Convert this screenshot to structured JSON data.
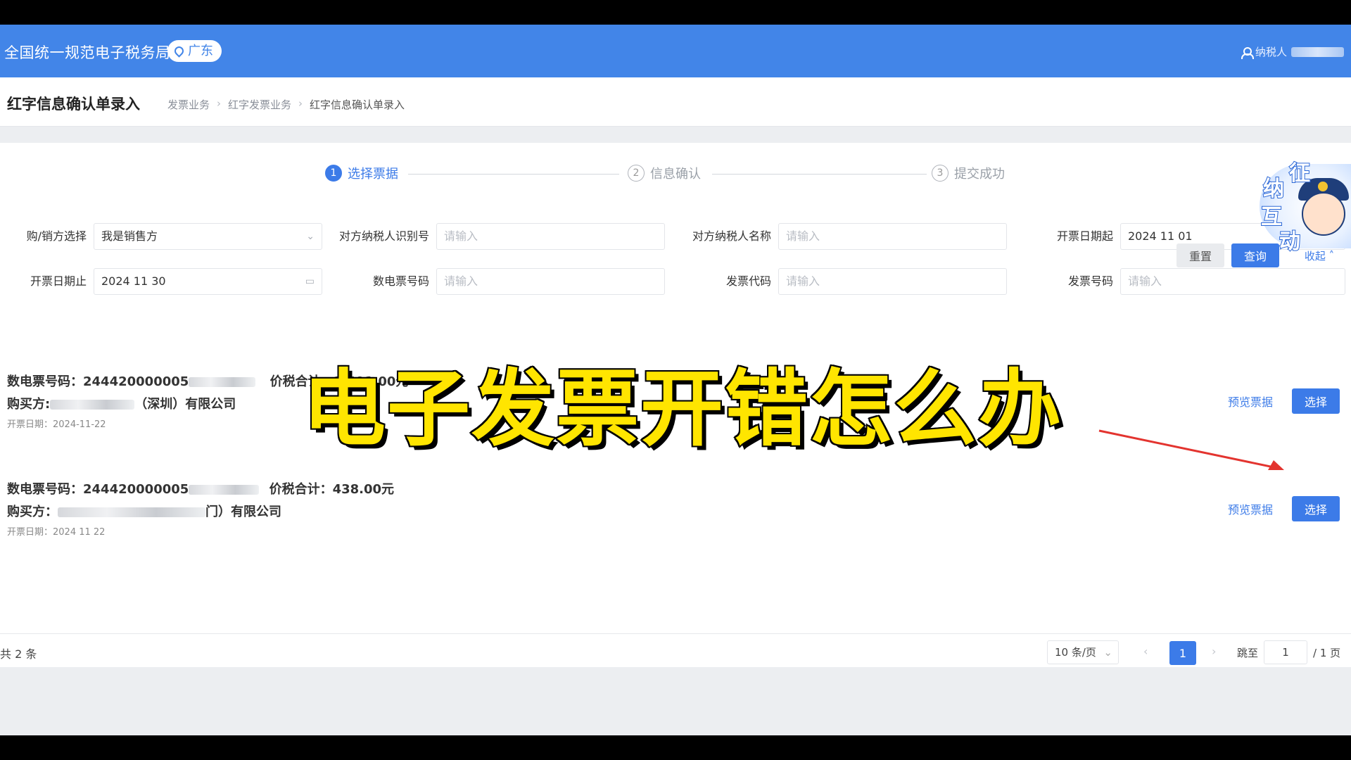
{
  "header": {
    "brand": "全国统一规范电子税务局",
    "region": "广东",
    "user": "纳税人"
  },
  "title_row": {
    "title": "红字信息确认单录入",
    "breadcrumbs": [
      "发票业务",
      "红字发票业务",
      "红字信息确认单录入"
    ]
  },
  "steps": [
    {
      "num": "1",
      "label": "选择票据"
    },
    {
      "num": "2",
      "label": "信息确认"
    },
    {
      "num": "3",
      "label": "提交成功"
    }
  ],
  "filters": {
    "role": {
      "label": "购/销方选择",
      "value": "我是销售方"
    },
    "taxpayer_id": {
      "label": "对方纳税人识别号",
      "placeholder": "请输入"
    },
    "taxpayer_name": {
      "label": "对方纳税人名称",
      "placeholder": "请输入"
    },
    "date_start": {
      "label": "开票日期起",
      "value": "2024 11 01"
    },
    "date_end": {
      "label": "开票日期止",
      "value": "2024 11 30"
    },
    "digital_no": {
      "label": "数电票号码",
      "placeholder": "请输入"
    },
    "invoice_code": {
      "label": "发票代码",
      "placeholder": "请输入"
    },
    "invoice_no": {
      "label": "发票号码",
      "placeholder": "请输入"
    }
  },
  "actions": {
    "reset": "重置",
    "query": "查询",
    "collapse": "收起"
  },
  "invoices": [
    {
      "no_label": "数电票号码：",
      "no_value": "244420000005",
      "total_label": "价税合计：",
      "total_value": "1,491.00元",
      "buyer_label": "购买方:",
      "buyer_suffix": "（深圳）有限公司",
      "date": "开票日期：2024-11-22",
      "preview": "预览票据",
      "select": "选择"
    },
    {
      "no_label": "数电票号码：",
      "no_value": "244420000005",
      "total_label": "价税合计：",
      "total_value": "438.00元",
      "buyer_label": "购买方：",
      "buyer_suffix": "门）有限公司",
      "date": "开票日期：2024 11 22",
      "preview": "预览票据",
      "select": "选择"
    }
  ],
  "pagination": {
    "total": "共 2 条",
    "page_size": "10 条/页",
    "current": "1",
    "jump_label": "跳至",
    "jump_value": "1",
    "pages_suffix": "/ 1 页"
  },
  "overlay": {
    "caption": "电子发票开错怎么办"
  },
  "mascot": {
    "chars": [
      "征",
      "纳",
      "互",
      "动"
    ]
  }
}
